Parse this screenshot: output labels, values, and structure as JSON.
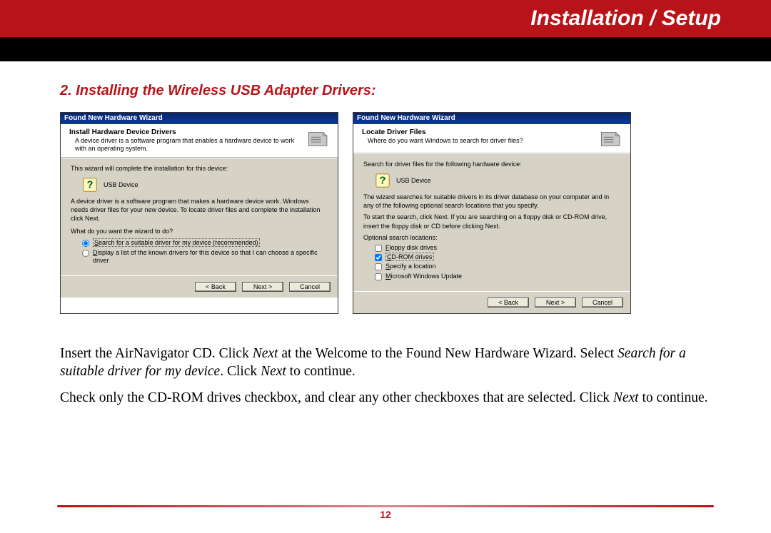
{
  "banner": {
    "title": "Installation / Setup"
  },
  "section": {
    "heading": "2. Installing the Wireless USB Adapter Drivers:"
  },
  "dialog1": {
    "title": "Found New Hardware Wizard",
    "head_bold": "Install Hardware Device Drivers",
    "head_sub": "A device driver is a software program that enables a hardware device to work with an operating system.",
    "line1": "This wizard will complete the installation for this device:",
    "device": "USB Device",
    "line2": "A device driver is a software program that makes a hardware device work. Windows needs driver files for your new device. To locate driver files and complete the installation click Next.",
    "line3": "What do you want the wizard to do?",
    "opt1_pre": "S",
    "opt1_rest": "earch for a suitable driver for my device (recommended)",
    "opt2_pre": "D",
    "opt2_rest": "isplay a list of the known drivers for this device so that I can choose a specific driver",
    "back": "< Back",
    "next": "Next >",
    "cancel": "Cancel"
  },
  "dialog2": {
    "title": "Found New Hardware Wizard",
    "head_bold": "Locate Driver Files",
    "head_sub": "Where do you want Windows to search for driver files?",
    "line1": "Search for driver files for the following hardware device:",
    "device": "USB Device",
    "line2": "The wizard searches for suitable drivers in its driver database on your computer and in any of the following optional search locations that you specify.",
    "line3": "To start the search, click Next. If you are searching on a floppy disk or CD-ROM drive, insert the floppy disk or CD before clicking Next.",
    "line4": "Optional search locations:",
    "chk1": "Floppy disk drives",
    "chk2": "CD-ROM drives",
    "chk3": "Specify a location",
    "chk4": "Microsoft Windows Update",
    "back": "< Back",
    "next": "Next >",
    "cancel": "Cancel"
  },
  "body": {
    "p1a": "Insert the AirNavigator CD.  Click ",
    "p1b": "Next",
    "p1c": " at the Welcome to the Found New Hardware Wizard.  Select ",
    "p1d": "Search for a suitable driver for my device",
    "p1e": ".  Click ",
    "p1f": "Next",
    "p1g": " to continue.",
    "p2a": "Check only the CD-ROM drives checkbox, and clear any other checkboxes that are selected.  Click ",
    "p2b": "Next",
    "p2c": " to continue."
  },
  "footer": {
    "page": "12"
  }
}
